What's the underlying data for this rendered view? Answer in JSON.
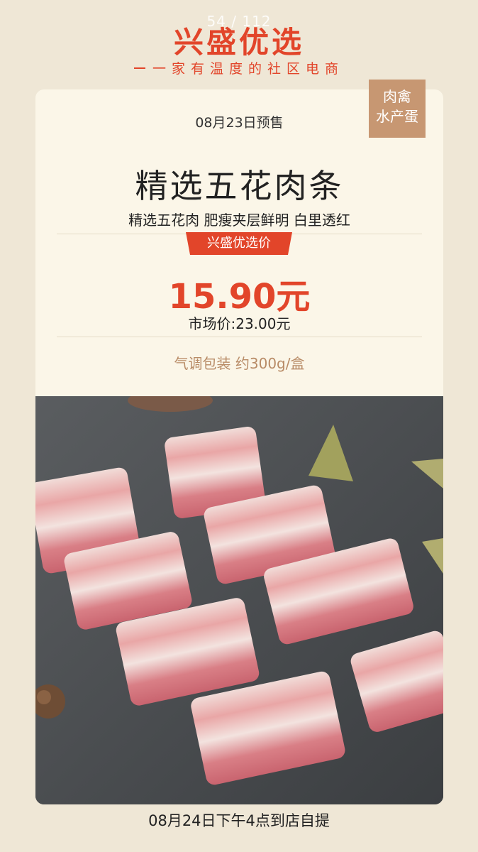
{
  "page_indicator": "54 / 112",
  "header": {
    "brand": "兴盛优选",
    "slogan": "一家有温度的社区电商"
  },
  "category_tag": {
    "line1": "肉禽",
    "line2": "水产蛋"
  },
  "product": {
    "presale_date": "08月23日预售",
    "title": "精选五花肉条",
    "subtitle": "精选五花肉 肥瘦夹层鲜明 白里透红",
    "price_badge": "兴盛优选价",
    "price": "15.90元",
    "market_price": "市场价:23.00元",
    "spec": "气调包装 约300g/盒",
    "image_icon": "pork-belly-photo"
  },
  "pickup_note": "08月24日下午4点到店自提",
  "colors": {
    "accent": "#e2452a",
    "background": "#efe7d6",
    "card": "#fbf6e8",
    "tag": "#c79772",
    "spec_text": "#b88b66"
  }
}
